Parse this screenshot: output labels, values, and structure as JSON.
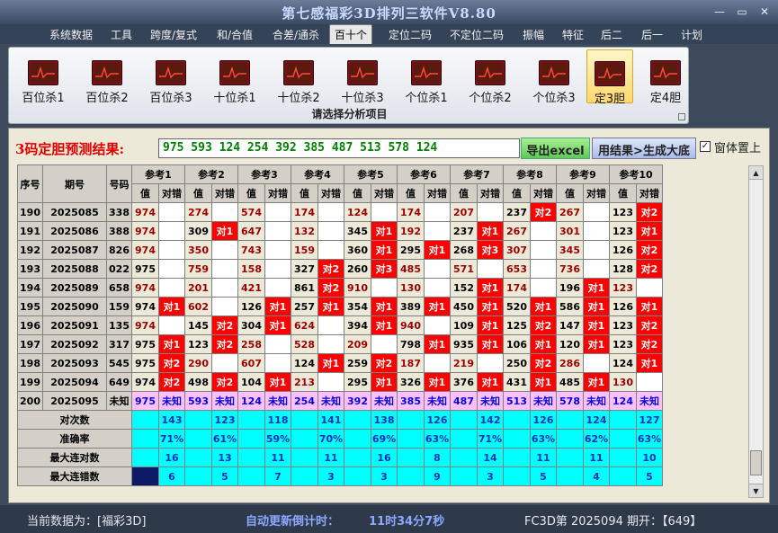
{
  "title": "第七感福彩3D排列三软件V8.80",
  "menu": [
    "系统数据",
    "工具",
    "跨度/复式",
    "和/合值",
    "合差/通杀",
    "百十个",
    "定位二码",
    "不定位二码",
    "振幅",
    "特征",
    "后二",
    "后一",
    "计划"
  ],
  "active_menu": "百十个",
  "ribbon": {
    "buttons": [
      "百位杀1",
      "百位杀2",
      "百位杀3",
      "十位杀1",
      "十位杀2",
      "十位杀3",
      "个位杀1",
      "个位杀2",
      "个位杀3",
      "定3胆",
      "定4胆"
    ],
    "selected": "定3胆",
    "caption": "请选择分析项目"
  },
  "prediction": {
    "label": "3码定胆预测结果:",
    "value": "975 593 124 254 392 385 487 513 578 124",
    "export_btn": "导出excel",
    "generate_btn": "用结果>生成大底",
    "pin_label": "窗体置上",
    "pin_checked": "✓"
  },
  "table": {
    "col_headers": [
      "序号",
      "期号",
      "号码"
    ],
    "ref_groups": [
      "参考1",
      "参考2",
      "参考3",
      "参考4",
      "参考5",
      "参考6",
      "参考7",
      "参考8",
      "参考9",
      "参考10"
    ],
    "sub_headers": [
      "值",
      "对错"
    ],
    "rows": [
      {
        "seq": "190",
        "period": "2025085",
        "num": "338",
        "refs": [
          [
            "974",
            ""
          ],
          [
            "274",
            ""
          ],
          [
            "574",
            ""
          ],
          [
            "174",
            ""
          ],
          [
            "124",
            ""
          ],
          [
            "174",
            ""
          ],
          [
            "207",
            ""
          ],
          [
            "237",
            "对2"
          ],
          [
            "267",
            ""
          ],
          [
            "123",
            "对2"
          ]
        ]
      },
      {
        "seq": "191",
        "period": "2025086",
        "num": "388",
        "refs": [
          [
            "974",
            ""
          ],
          [
            "309",
            "对1"
          ],
          [
            "647",
            ""
          ],
          [
            "132",
            ""
          ],
          [
            "345",
            "对1"
          ],
          [
            "192",
            ""
          ],
          [
            "237",
            "对1"
          ],
          [
            "267",
            ""
          ],
          [
            "301",
            ""
          ],
          [
            "123",
            "对1"
          ]
        ]
      },
      {
        "seq": "192",
        "period": "2025087",
        "num": "826",
        "refs": [
          [
            "974",
            ""
          ],
          [
            "350",
            ""
          ],
          [
            "743",
            ""
          ],
          [
            "159",
            ""
          ],
          [
            "360",
            "对1"
          ],
          [
            "295",
            "对1"
          ],
          [
            "268",
            "对3"
          ],
          [
            "307",
            ""
          ],
          [
            "345",
            ""
          ],
          [
            "126",
            "对2"
          ]
        ]
      },
      {
        "seq": "193",
        "period": "2025088",
        "num": "022",
        "refs": [
          [
            "975",
            ""
          ],
          [
            "759",
            ""
          ],
          [
            "158",
            ""
          ],
          [
            "327",
            "对2"
          ],
          [
            "260",
            "对3"
          ],
          [
            "485",
            ""
          ],
          [
            "571",
            ""
          ],
          [
            "653",
            ""
          ],
          [
            "736",
            ""
          ],
          [
            "128",
            "对2"
          ]
        ]
      },
      {
        "seq": "194",
        "period": "2025089",
        "num": "658",
        "refs": [
          [
            "974",
            ""
          ],
          [
            "201",
            ""
          ],
          [
            "421",
            ""
          ],
          [
            "861",
            "对2"
          ],
          [
            "910",
            ""
          ],
          [
            "130",
            ""
          ],
          [
            "152",
            "对1"
          ],
          [
            "174",
            ""
          ],
          [
            "196",
            "对1"
          ],
          [
            "123",
            ""
          ]
        ]
      },
      {
        "seq": "195",
        "period": "2025090",
        "num": "159",
        "refs": [
          [
            "974",
            "对1"
          ],
          [
            "602",
            ""
          ],
          [
            "126",
            "对1"
          ],
          [
            "257",
            "对1"
          ],
          [
            "354",
            "对1"
          ],
          [
            "389",
            "对1"
          ],
          [
            "450",
            "对1"
          ],
          [
            "520",
            "对1"
          ],
          [
            "586",
            "对1"
          ],
          [
            "126",
            "对1"
          ]
        ]
      },
      {
        "seq": "196",
        "period": "2025091",
        "num": "135",
        "refs": [
          [
            "974",
            ""
          ],
          [
            "145",
            "对2"
          ],
          [
            "304",
            "对1"
          ],
          [
            "624",
            ""
          ],
          [
            "394",
            "对1"
          ],
          [
            "940",
            ""
          ],
          [
            "109",
            "对1"
          ],
          [
            "125",
            "对2"
          ],
          [
            "147",
            "对1"
          ],
          [
            "123",
            "对2"
          ]
        ]
      },
      {
        "seq": "197",
        "period": "2025092",
        "num": "317",
        "refs": [
          [
            "975",
            "对1"
          ],
          [
            "123",
            "对2"
          ],
          [
            "258",
            ""
          ],
          [
            "528",
            ""
          ],
          [
            "209",
            ""
          ],
          [
            "798",
            "对1"
          ],
          [
            "935",
            "对1"
          ],
          [
            "106",
            "对1"
          ],
          [
            "120",
            "对1"
          ],
          [
            "123",
            "对2"
          ]
        ]
      },
      {
        "seq": "198",
        "period": "2025093",
        "num": "545",
        "refs": [
          [
            "975",
            "对2"
          ],
          [
            "290",
            ""
          ],
          [
            "607",
            ""
          ],
          [
            "124",
            "对1"
          ],
          [
            "259",
            "对2"
          ],
          [
            "187",
            ""
          ],
          [
            "219",
            ""
          ],
          [
            "250",
            "对2"
          ],
          [
            "286",
            ""
          ],
          [
            "124",
            "对1"
          ]
        ]
      },
      {
        "seq": "199",
        "period": "2025094",
        "num": "649",
        "refs": [
          [
            "974",
            "对2"
          ],
          [
            "498",
            "对2"
          ],
          [
            "104",
            "对1"
          ],
          [
            "213",
            ""
          ],
          [
            "295",
            "对1"
          ],
          [
            "326",
            "对1"
          ],
          [
            "376",
            "对1"
          ],
          [
            "431",
            "对1"
          ],
          [
            "485",
            "对1"
          ],
          [
            "130",
            ""
          ]
        ]
      },
      {
        "seq": "200",
        "period": "2025095",
        "num": "未知",
        "refs": [
          [
            "975",
            "未知"
          ],
          [
            "593",
            "未知"
          ],
          [
            "124",
            "未知"
          ],
          [
            "254",
            "未知"
          ],
          [
            "392",
            "未知"
          ],
          [
            "385",
            "未知"
          ],
          [
            "487",
            "未知"
          ],
          [
            "513",
            "未知"
          ],
          [
            "578",
            "未知"
          ],
          [
            "124",
            "未知"
          ]
        ]
      }
    ],
    "stats": [
      {
        "label": "对次数",
        "values": [
          "143",
          "123",
          "118",
          "141",
          "138",
          "126",
          "142",
          "126",
          "124",
          "127"
        ]
      },
      {
        "label": "准确率",
        "values": [
          "71%",
          "61%",
          "59%",
          "70%",
          "69%",
          "63%",
          "71%",
          "63%",
          "62%",
          "63%"
        ]
      },
      {
        "label": "最大连对数",
        "values": [
          "16",
          "13",
          "11",
          "11",
          "16",
          "8",
          "14",
          "11",
          "11",
          "10"
        ]
      },
      {
        "label": "最大连错数",
        "values": [
          "6",
          "5",
          "7",
          "3",
          "3",
          "9",
          "3",
          "5",
          "4",
          "5"
        ]
      }
    ]
  },
  "status": {
    "current": "当前数据为：[福彩3D]",
    "countdown_label": "自动更新倒计时：",
    "countdown": "11时34分7秒",
    "issue": "FC3D第 2025094 期开：【649】"
  },
  "colors": {
    "hit": "#ff0000",
    "stats": "#00ffff",
    "unknown": "#ffc0ff",
    "prediction_text": "#008000"
  }
}
